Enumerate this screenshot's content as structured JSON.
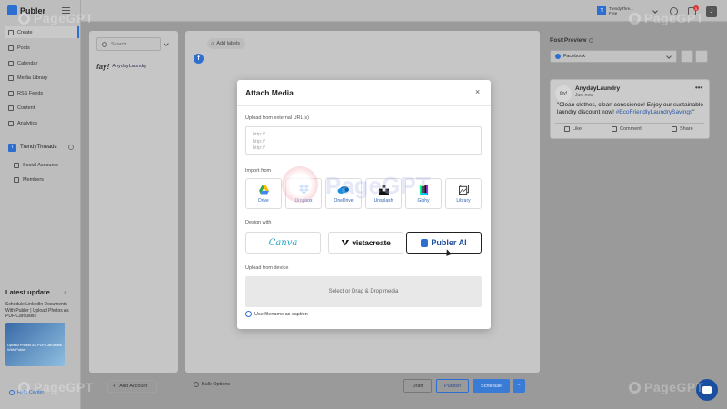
{
  "app": {
    "logo_text": "Publer",
    "brand_color": "#2d6fd1"
  },
  "sidebar": {
    "items": [
      {
        "label": "Create",
        "icon": "pencil-icon",
        "active": true
      },
      {
        "label": "Posts",
        "icon": "document-icon"
      },
      {
        "label": "Calendar",
        "icon": "calendar-icon"
      },
      {
        "label": "Media Library",
        "icon": "image-icon"
      },
      {
        "label": "RSS Feeds",
        "icon": "rss-icon"
      },
      {
        "label": "Content",
        "icon": "folder-icon"
      },
      {
        "label": "Analytics",
        "icon": "chart-icon"
      }
    ],
    "workspace": {
      "badge": "T",
      "name": "TrendyThreads"
    },
    "workspace_items": [
      {
        "label": "Social Accounts",
        "icon": "accounts-icon"
      },
      {
        "label": "Members",
        "icon": "members-icon"
      }
    ],
    "update": {
      "title": "Latest update",
      "text": "Schedule LinkedIn Documents With Publer | Upload Photos As PDF Carousels",
      "thumb_text": "Upload Photos As PDF Carousels With Publer"
    },
    "help_label": "Help Center"
  },
  "topbar": {
    "account_name": "TrendyThre...",
    "account_plan": "Free",
    "account_badge": "T",
    "notification_count": "1",
    "avatar_letter": "J"
  },
  "accounts": {
    "search_placeholder": "Search",
    "account_name": "AnydayLaundry",
    "account_logo": "fay!",
    "add_account_label": "Add Account"
  },
  "composer": {
    "add_labels": "Add labels",
    "bulk_options": "Bulk Options",
    "draft_label": "Draft",
    "publish_label": "Publish",
    "schedule_label": "Schedule"
  },
  "preview": {
    "title": "Post Preview",
    "network": "Facebook",
    "post": {
      "avatar_text": "fay!",
      "name": "AnydayLaundry",
      "time": "Just now",
      "text": "\"Clean clothes, clean conscience! Enjoy our sustainable laundry discount now! ",
      "hashtag": "#EcoFriendlyLaundrySavings",
      "text_end": "\"",
      "actions": [
        "Like",
        "Comment",
        "Share"
      ]
    }
  },
  "modal": {
    "title": "Attach Media",
    "close_glyph": "×",
    "url_section_label": "Upload from external URL(s)",
    "url_placeholder_lines": [
      "http://",
      "http://",
      "http://"
    ],
    "import_label": "Import from",
    "import_sources": [
      {
        "label": "Drive",
        "icon": "google-drive-icon",
        "color": "#34a853"
      },
      {
        "label": "Dropbox",
        "icon": "dropbox-icon",
        "color": "#0061fe"
      },
      {
        "label": "OneDrive",
        "icon": "onedrive-icon",
        "color": "#0364b8"
      },
      {
        "label": "Unsplash",
        "icon": "unsplash-icon",
        "color": "#111111"
      },
      {
        "label": "Giphy",
        "icon": "giphy-icon",
        "color": "#9933ff"
      },
      {
        "label": "Library",
        "icon": "library-icon",
        "color": "#333333"
      }
    ],
    "design_label": "Design with",
    "design_tools": [
      {
        "label": "Canva"
      },
      {
        "label": "vistacreate"
      },
      {
        "label": "Publer AI"
      }
    ],
    "device_label": "Upload from device",
    "dropzone_text": "Select or Drag & Drop media",
    "caption_option": "Use filename as caption"
  },
  "watermark": "PageGPT"
}
